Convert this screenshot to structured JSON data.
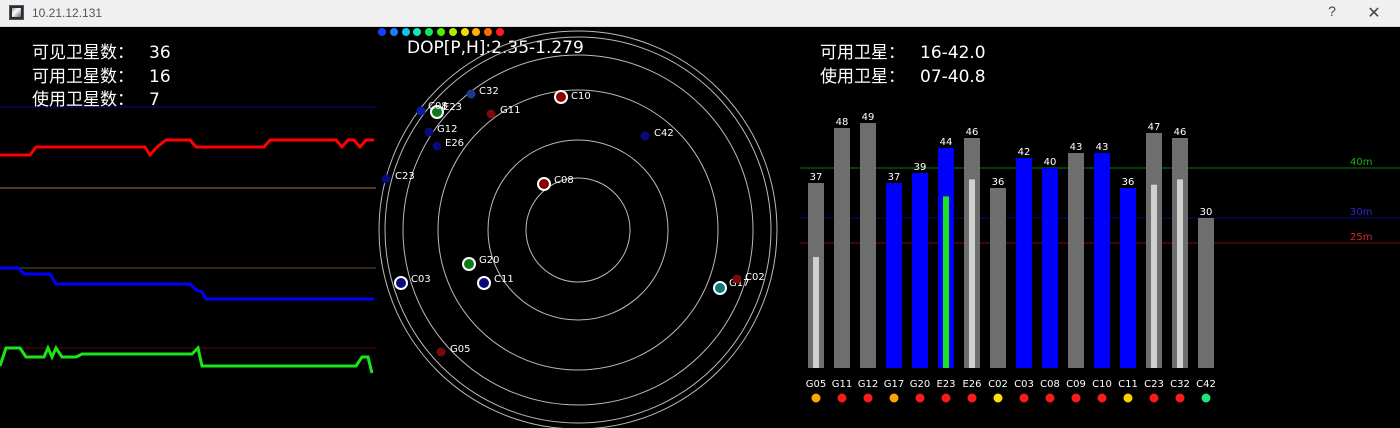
{
  "window": {
    "title": "10.21.12.131",
    "help_glyph": "?",
    "close_glyph": "✕"
  },
  "stats": {
    "visible_label": "可见卫星数：",
    "visible_value": "36",
    "usable_label": "可用卫星数：",
    "usable_value": "16",
    "used_label": "使用卫星数：",
    "used_value": "7"
  },
  "dop": {
    "text": "DOP[P,H]:2.35-1.279"
  },
  "summary": {
    "available_label": "可用卫星：",
    "available_value": "16-42.0",
    "used_label": "使用卫星：",
    "used_value": "07-40.8"
  },
  "legend_dots": [
    "#1a3cff",
    "#1a7dff",
    "#13c3e8",
    "#13e8b0",
    "#13e85a",
    "#4ef000",
    "#aaf000",
    "#f0e000",
    "#ffb000",
    "#ff6a00",
    "#ff1a1a"
  ],
  "skyplot": {
    "satellites": [
      {
        "id": "C10",
        "color": "#8b0000",
        "ring": "#ffffff",
        "big": true
      },
      {
        "id": "C08",
        "color": "#8b0000",
        "ring": "#ffffff",
        "big": true
      },
      {
        "id": "G20",
        "color": "#0c7a1a",
        "ring": "#ffffff",
        "big": true
      },
      {
        "id": "C11",
        "color": "#0a0a7a",
        "ring": "#ffffff",
        "big": true
      },
      {
        "id": "C03",
        "color": "#0a0a7a",
        "ring": "#ffffff",
        "big": true
      },
      {
        "id": "G17",
        "color": "#0c7a7a",
        "ring": "#ffffff",
        "big": true
      },
      {
        "id": "E23",
        "color": "#0c7a1a",
        "ring": "#ffffff",
        "big": true
      },
      {
        "id": "C08",
        "color": "#0b1aa0",
        "ring": null,
        "big": false
      },
      {
        "id": "C32",
        "color": "#1a3a8a",
        "ring": null,
        "big": false
      },
      {
        "id": "G11",
        "color": "#7a0a0a",
        "ring": null,
        "big": false
      },
      {
        "id": "G12",
        "color": "#0a0a7a",
        "ring": null,
        "big": false
      },
      {
        "id": "E26",
        "color": "#0a0a7a",
        "ring": null,
        "big": false
      },
      {
        "id": "C42",
        "color": "#0a0a7a",
        "ring": null,
        "big": false
      },
      {
        "id": "C23",
        "color": "#0a0a7a",
        "ring": null,
        "big": false
      },
      {
        "id": "C02",
        "color": "#7a0a0a",
        "ring": null,
        "big": false
      },
      {
        "id": "G05",
        "color": "#7a0a0a",
        "ring": null,
        "big": false
      }
    ]
  },
  "chart_data": {
    "type": "bar",
    "categories": [
      "G05",
      "G11",
      "G12",
      "G17",
      "G20",
      "E23",
      "E26",
      "C02",
      "C03",
      "C08",
      "C09",
      "C10",
      "C11",
      "C23",
      "C32",
      "C42"
    ],
    "values": [
      37,
      48,
      49,
      37,
      39,
      44,
      46,
      36,
      42,
      40,
      43,
      43,
      36,
      47,
      46,
      30
    ],
    "bar_colors": [
      "#6e6e6e",
      "#6e6e6e",
      "#6e6e6e",
      "#0000ff",
      "#0000ff",
      "#0000ff",
      "#6e6e6e",
      "#6e6e6e",
      "#0000ff",
      "#0000ff",
      "#6e6e6e",
      "#0000ff",
      "#0000ff",
      "#6e6e6e",
      "#6e6e6e",
      "#6e6e6e"
    ],
    "inner_fill": [
      0.6,
      0,
      0,
      0,
      0,
      0.78,
      0.82,
      0,
      0,
      0,
      0,
      0,
      0,
      0.78,
      0.82,
      0
    ],
    "inner_colors": [
      "#d0d0d0",
      "#d0d0d0",
      "#d0d0d0",
      "#d0d0d0",
      "#d0d0d0",
      "#19e619",
      "#d0d0d0",
      "#d0d0d0",
      "#d0d0d0",
      "#d0d0d0",
      "#d0d0d0",
      "#d0d0d0",
      "#d0d0d0",
      "#d0d0d0",
      "#d0d0d0",
      "#d0d0d0"
    ],
    "status_dots": [
      "#ffa500",
      "#ff1a1a",
      "#ff1a1a",
      "#ffa500",
      "#ff1a1a",
      "#ff1a1a",
      "#ff1a1a",
      "#ffe000",
      "#ff1a1a",
      "#ff1a1a",
      "#ff1a1a",
      "#ff1a1a",
      "#ffd000",
      "#ff1a1a",
      "#ff1a1a",
      "#19e680"
    ],
    "ylim": [
      0,
      58
    ],
    "reference_lines": [
      {
        "label": "40m",
        "value": 40,
        "color": "#0a7a0a"
      },
      {
        "label": "30m",
        "value": 30,
        "color": "#0a0a7a"
      },
      {
        "label": "25m",
        "value": 25,
        "color": "#7a0a0a"
      }
    ]
  }
}
